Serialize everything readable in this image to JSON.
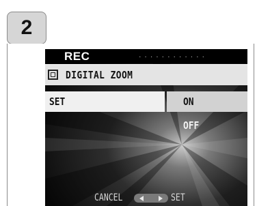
{
  "step": {
    "number": "2"
  },
  "screen": {
    "header": {
      "title": "REC",
      "dots": "............"
    },
    "menu": {
      "icon": "digital-zoom-icon",
      "title": "DIGITAL ZOOM"
    },
    "row": {
      "label": "SET",
      "options": [
        {
          "label": "ON",
          "selected": true
        },
        {
          "label": "OFF",
          "selected": false
        }
      ]
    },
    "footer": {
      "cancel_label": "CANCEL",
      "set_label": "SET"
    }
  },
  "colors": {
    "highlight_row": "#f0f0f0",
    "selected_option": "#d2d2d2",
    "menu_bar": "#e4e4e4",
    "screen_background": "#111111"
  }
}
